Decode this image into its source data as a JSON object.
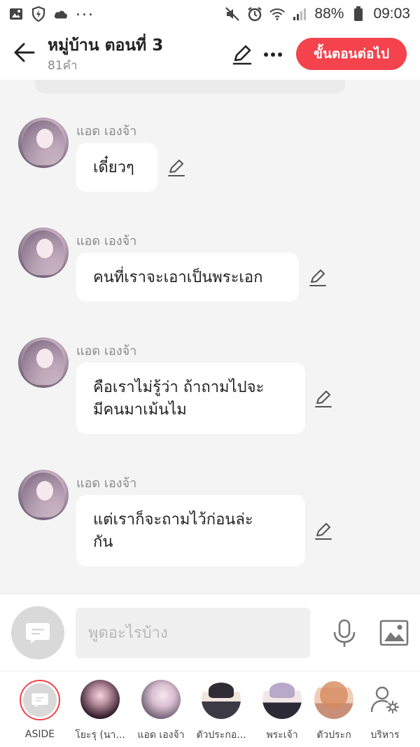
{
  "status_bar": {
    "battery": "88%",
    "time": "09:03"
  },
  "header": {
    "title": "หมู่บ้าน ตอนที่ 3",
    "word_count": "81คำ",
    "next_button": "ขั้นตอนต่อไป"
  },
  "messages": [
    {
      "sender": "แอด เองจ้า",
      "lines": [
        "เดี๋ยวๆ"
      ]
    },
    {
      "sender": "แอด เองจ้า",
      "lines": [
        "คนที่เราจะเอาเป็นพระเอก"
      ]
    },
    {
      "sender": "แอด เองจ้า",
      "lines": [
        "คือเราไม่รู้ว่า ถ้าถามไปจะ",
        "มีคนมาเม้นไม"
      ]
    },
    {
      "sender": "แอด เองจ้า",
      "lines": [
        "แต่เราก็จะถามไว้ก่อนล่ะ",
        "กัน"
      ]
    }
  ],
  "input": {
    "placeholder": "พูดอะไรบ้าง"
  },
  "characters": [
    {
      "label": "ASIDE"
    },
    {
      "label": "โยะรุ (นา..."
    },
    {
      "label": "แอด เองจ้า"
    },
    {
      "label": "ตัวประกอ..."
    },
    {
      "label": "พระเจ้า"
    },
    {
      "label": "ตัวประก"
    },
    {
      "label": "บริหาร"
    }
  ],
  "colors": {
    "accent": "#f4434c",
    "background": "#f4f4f4",
    "bubble": "#ffffff"
  },
  "icons": {
    "back": "arrow-left-icon",
    "edit": "pencil-icon",
    "more": "more-icon",
    "mic": "mic-icon",
    "image": "image-icon",
    "chat": "chat-bubble-icon",
    "manage": "user-settings-icon"
  }
}
